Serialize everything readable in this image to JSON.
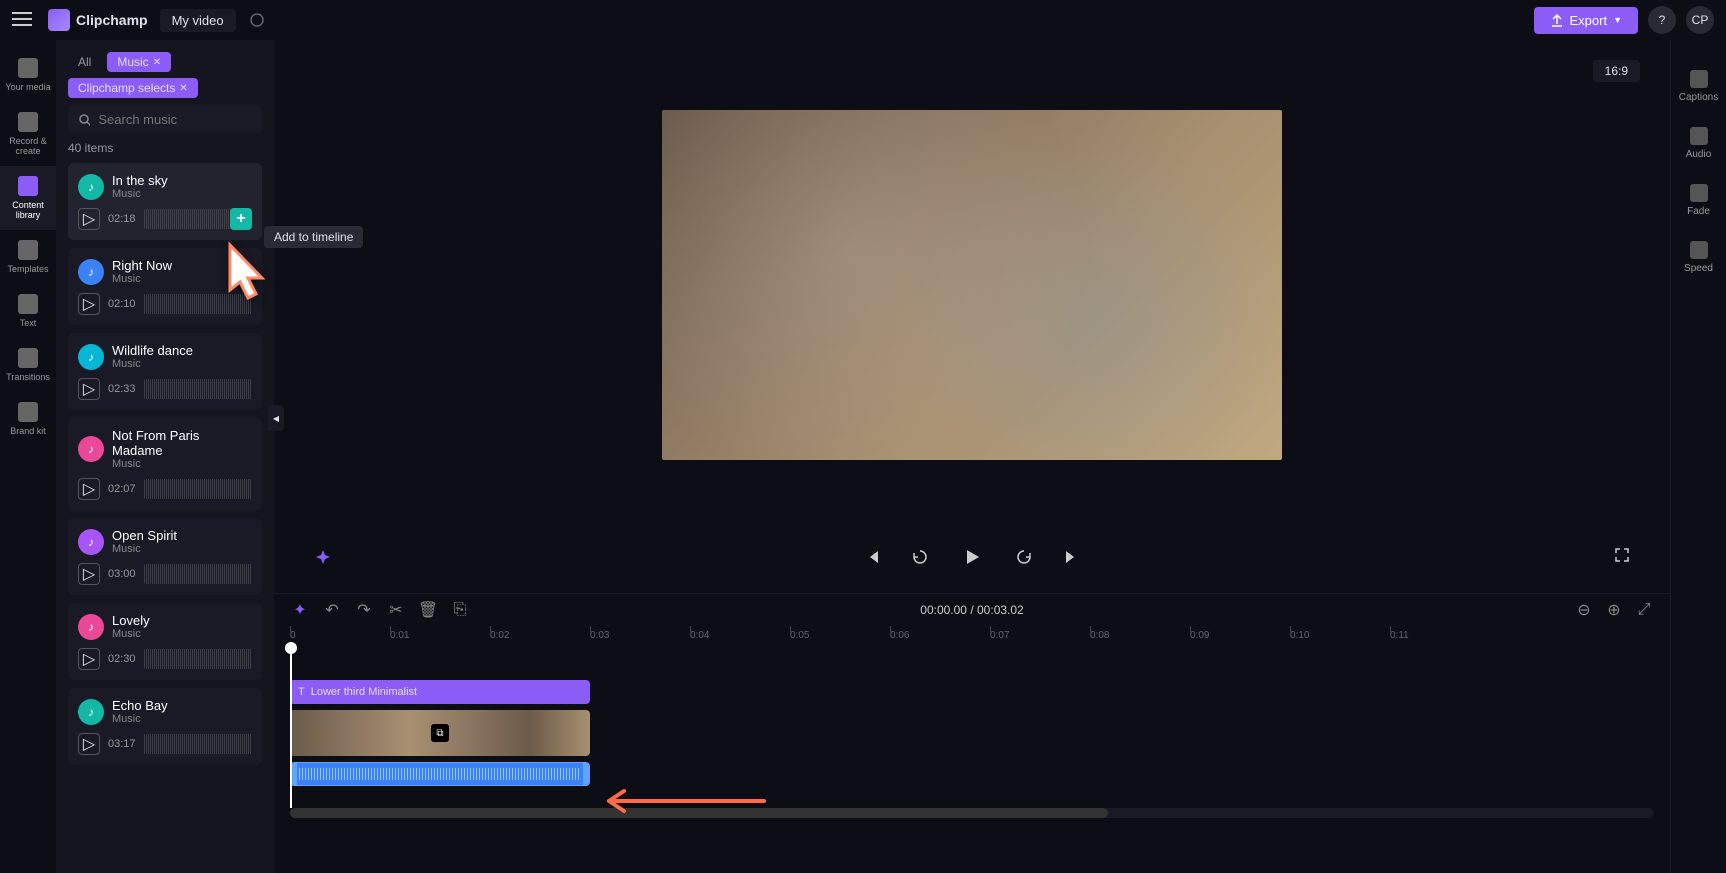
{
  "header": {
    "app_name": "Clipchamp",
    "project_name": "My video",
    "export_label": "Export",
    "avatar_initials": "CP",
    "aspect_ratio": "16:9"
  },
  "left_nav": [
    {
      "label": "Your media"
    },
    {
      "label": "Record & create"
    },
    {
      "label": "Content library"
    },
    {
      "label": "Templates"
    },
    {
      "label": "Text"
    },
    {
      "label": "Transitions"
    },
    {
      "label": "Brand kit"
    }
  ],
  "panel": {
    "filter_all": "All",
    "filter_music": "Music",
    "filter_selects": "Clipchamp selects",
    "search_placeholder": "Search music",
    "items_count": "40 items",
    "tooltip": "Add to timeline",
    "tracks": [
      {
        "title": "In the sky",
        "sub": "Music",
        "duration": "02:18",
        "color": "teal"
      },
      {
        "title": "Right Now",
        "sub": "Music",
        "duration": "02:10",
        "color": "blue"
      },
      {
        "title": "Wildlife dance",
        "sub": "Music",
        "duration": "02:33",
        "color": "cyan"
      },
      {
        "title": "Not From Paris Madame",
        "sub": "Music",
        "duration": "02:07",
        "color": "pink"
      },
      {
        "title": "Open Spirit",
        "sub": "Music",
        "duration": "03:00",
        "color": "purple"
      },
      {
        "title": "Lovely",
        "sub": "Music",
        "duration": "02:30",
        "color": "pink"
      },
      {
        "title": "Echo Bay",
        "sub": "Music",
        "duration": "03:17",
        "color": "teal"
      }
    ]
  },
  "timeline": {
    "current_time": "00:00.00",
    "total_time": "00:03.02",
    "ruler": [
      "0",
      "0:01",
      "0:02",
      "0:03",
      "0:04",
      "0:05",
      "0:06",
      "0:07",
      "0:08",
      "0:09",
      "0:10",
      "0:11"
    ],
    "title_clip": "Lower third Minimalist"
  },
  "right_rail": [
    {
      "label": "Captions"
    },
    {
      "label": "Audio"
    },
    {
      "label": "Fade"
    },
    {
      "label": "Speed"
    }
  ]
}
